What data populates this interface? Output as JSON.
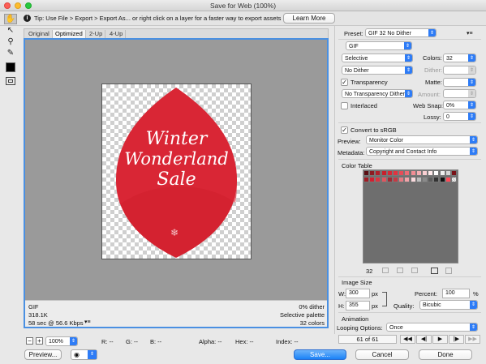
{
  "window": {
    "title": "Save for Web (100%)"
  },
  "tip": {
    "text": "Tip: Use File > Export > Export As... or right click on a layer for a faster way to export assets",
    "learn_more": "Learn More"
  },
  "tabs": [
    "Original",
    "Optimized",
    "2-Up",
    "4-Up"
  ],
  "image": {
    "line1": "Winter",
    "line2": "Wonderland",
    "line3": "Sale",
    "ornament": "❄"
  },
  "image_info": {
    "format": "GIF",
    "size": "318.1K",
    "time": "58 sec @ 56.6 Kbps",
    "dither": "0% dither",
    "palette": "Selective palette",
    "colors": "32 colors",
    "menu_glyph": "▾≡"
  },
  "status": {
    "zoom": "100%",
    "r": "R: --",
    "g": "G: --",
    "b": "B: --",
    "alpha": "Alpha: --",
    "hex": "Hex: --",
    "index": "Index: --"
  },
  "bottom_buttons": {
    "preview": "Preview...",
    "save": "Save...",
    "cancel": "Cancel",
    "done": "Done"
  },
  "settings": {
    "preset_label": "Preset:",
    "preset_value": "GIF 32 No Dither",
    "menu_glyph": "▾≡",
    "format": "GIF",
    "reduction": "Selective",
    "colors_label": "Colors:",
    "colors_value": "32",
    "dither_algo": "No Dither",
    "dither_label": "Dither:",
    "dither_value": "",
    "transparency": "Transparency",
    "matte_label": "Matte:",
    "matte_value": "",
    "transp_dither": "No Transparency Dither",
    "amount_label": "Amount:",
    "amount_value": "",
    "interlaced": "Interlaced",
    "websnap_label": "Web Snap:",
    "websnap_value": "0%",
    "lossy_label": "Lossy:",
    "lossy_value": "0",
    "convert_srgb": "Convert to sRGB",
    "preview_label": "Preview:",
    "preview_value": "Monitor Color",
    "metadata_label": "Metadata:",
    "metadata_value": "Copyright and Contact Info"
  },
  "color_table": {
    "title": "Color Table",
    "count": "32",
    "swatches": [
      "#5a0f14",
      "#8e1b22",
      "#b21f2a",
      "#c8202c",
      "#d62836",
      "#e23340",
      "#e84c57",
      "#ee6b74",
      "#f28d94",
      "#f6afb4",
      "#f9cfd2",
      "#fde9ea",
      "#ffffff",
      "#efefef",
      "#d6d6d6",
      "#7a1218",
      "#a01c25",
      "#d21f30",
      "#db3440",
      "#e0555f",
      "#9e2a33",
      "#c33a44",
      "#e57a82",
      "#f2a3a9",
      "#fadadd",
      "#bdbdbd",
      "#8a8a8a",
      "#5c5c5c",
      "#333333",
      "#101010",
      "#ff4a58",
      "transparent"
    ]
  },
  "image_size": {
    "title": "Image Size",
    "w_label": "W:",
    "w_value": "300",
    "h_label": "H:",
    "h_value": "355",
    "unit": "px",
    "percent_label": "Percent:",
    "percent_value": "100",
    "percent_unit": "%",
    "quality_label": "Quality:",
    "quality_value": "Bicubic"
  },
  "animation": {
    "title": "Animation",
    "looping_label": "Looping Options:",
    "looping_value": "Once",
    "frame": "61 of 61"
  },
  "colors": {
    "accent": "#2e7cf6",
    "leaf": "#d42230",
    "canvas_bg": "#9a9a9a"
  }
}
